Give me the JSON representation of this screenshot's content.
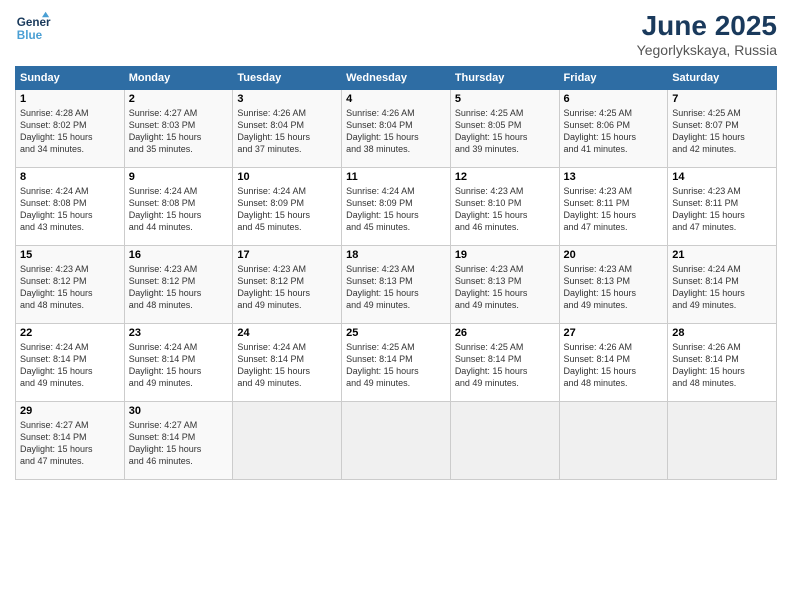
{
  "header": {
    "logo_line1": "General",
    "logo_line2": "Blue",
    "title": "June 2025",
    "subtitle": "Yegorlykskaya, Russia"
  },
  "columns": [
    "Sunday",
    "Monday",
    "Tuesday",
    "Wednesday",
    "Thursday",
    "Friday",
    "Saturday"
  ],
  "weeks": [
    [
      {
        "day": "1",
        "info": "Sunrise: 4:28 AM\nSunset: 8:02 PM\nDaylight: 15 hours\nand 34 minutes."
      },
      {
        "day": "2",
        "info": "Sunrise: 4:27 AM\nSunset: 8:03 PM\nDaylight: 15 hours\nand 35 minutes."
      },
      {
        "day": "3",
        "info": "Sunrise: 4:26 AM\nSunset: 8:04 PM\nDaylight: 15 hours\nand 37 minutes."
      },
      {
        "day": "4",
        "info": "Sunrise: 4:26 AM\nSunset: 8:04 PM\nDaylight: 15 hours\nand 38 minutes."
      },
      {
        "day": "5",
        "info": "Sunrise: 4:25 AM\nSunset: 8:05 PM\nDaylight: 15 hours\nand 39 minutes."
      },
      {
        "day": "6",
        "info": "Sunrise: 4:25 AM\nSunset: 8:06 PM\nDaylight: 15 hours\nand 41 minutes."
      },
      {
        "day": "7",
        "info": "Sunrise: 4:25 AM\nSunset: 8:07 PM\nDaylight: 15 hours\nand 42 minutes."
      }
    ],
    [
      {
        "day": "8",
        "info": "Sunrise: 4:24 AM\nSunset: 8:08 PM\nDaylight: 15 hours\nand 43 minutes."
      },
      {
        "day": "9",
        "info": "Sunrise: 4:24 AM\nSunset: 8:08 PM\nDaylight: 15 hours\nand 44 minutes."
      },
      {
        "day": "10",
        "info": "Sunrise: 4:24 AM\nSunset: 8:09 PM\nDaylight: 15 hours\nand 45 minutes."
      },
      {
        "day": "11",
        "info": "Sunrise: 4:24 AM\nSunset: 8:09 PM\nDaylight: 15 hours\nand 45 minutes."
      },
      {
        "day": "12",
        "info": "Sunrise: 4:23 AM\nSunset: 8:10 PM\nDaylight: 15 hours\nand 46 minutes."
      },
      {
        "day": "13",
        "info": "Sunrise: 4:23 AM\nSunset: 8:11 PM\nDaylight: 15 hours\nand 47 minutes."
      },
      {
        "day": "14",
        "info": "Sunrise: 4:23 AM\nSunset: 8:11 PM\nDaylight: 15 hours\nand 47 minutes."
      }
    ],
    [
      {
        "day": "15",
        "info": "Sunrise: 4:23 AM\nSunset: 8:12 PM\nDaylight: 15 hours\nand 48 minutes."
      },
      {
        "day": "16",
        "info": "Sunrise: 4:23 AM\nSunset: 8:12 PM\nDaylight: 15 hours\nand 48 minutes."
      },
      {
        "day": "17",
        "info": "Sunrise: 4:23 AM\nSunset: 8:12 PM\nDaylight: 15 hours\nand 49 minutes."
      },
      {
        "day": "18",
        "info": "Sunrise: 4:23 AM\nSunset: 8:13 PM\nDaylight: 15 hours\nand 49 minutes."
      },
      {
        "day": "19",
        "info": "Sunrise: 4:23 AM\nSunset: 8:13 PM\nDaylight: 15 hours\nand 49 minutes."
      },
      {
        "day": "20",
        "info": "Sunrise: 4:23 AM\nSunset: 8:13 PM\nDaylight: 15 hours\nand 49 minutes."
      },
      {
        "day": "21",
        "info": "Sunrise: 4:24 AM\nSunset: 8:14 PM\nDaylight: 15 hours\nand 49 minutes."
      }
    ],
    [
      {
        "day": "22",
        "info": "Sunrise: 4:24 AM\nSunset: 8:14 PM\nDaylight: 15 hours\nand 49 minutes."
      },
      {
        "day": "23",
        "info": "Sunrise: 4:24 AM\nSunset: 8:14 PM\nDaylight: 15 hours\nand 49 minutes."
      },
      {
        "day": "24",
        "info": "Sunrise: 4:24 AM\nSunset: 8:14 PM\nDaylight: 15 hours\nand 49 minutes."
      },
      {
        "day": "25",
        "info": "Sunrise: 4:25 AM\nSunset: 8:14 PM\nDaylight: 15 hours\nand 49 minutes."
      },
      {
        "day": "26",
        "info": "Sunrise: 4:25 AM\nSunset: 8:14 PM\nDaylight: 15 hours\nand 49 minutes."
      },
      {
        "day": "27",
        "info": "Sunrise: 4:26 AM\nSunset: 8:14 PM\nDaylight: 15 hours\nand 48 minutes."
      },
      {
        "day": "28",
        "info": "Sunrise: 4:26 AM\nSunset: 8:14 PM\nDaylight: 15 hours\nand 48 minutes."
      }
    ],
    [
      {
        "day": "29",
        "info": "Sunrise: 4:27 AM\nSunset: 8:14 PM\nDaylight: 15 hours\nand 47 minutes."
      },
      {
        "day": "30",
        "info": "Sunrise: 4:27 AM\nSunset: 8:14 PM\nDaylight: 15 hours\nand 46 minutes."
      },
      {
        "day": "",
        "info": ""
      },
      {
        "day": "",
        "info": ""
      },
      {
        "day": "",
        "info": ""
      },
      {
        "day": "",
        "info": ""
      },
      {
        "day": "",
        "info": ""
      }
    ]
  ]
}
